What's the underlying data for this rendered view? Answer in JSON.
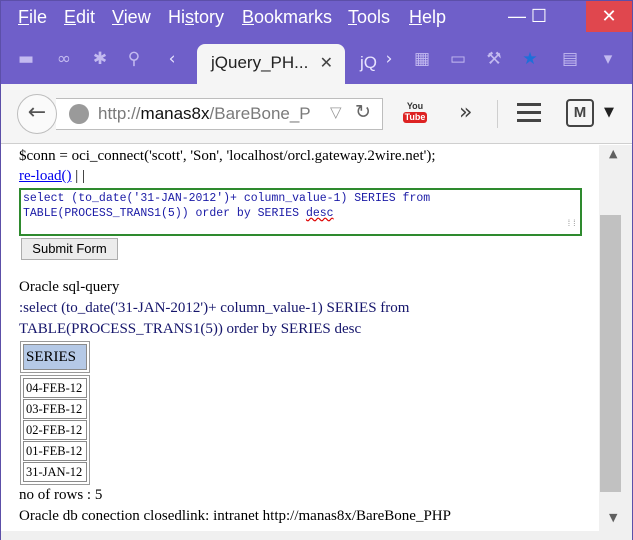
{
  "menubar": {
    "items": [
      "File",
      "Edit",
      "View",
      "History",
      "Bookmarks",
      "Tools",
      "Help"
    ],
    "underline_keys": [
      "F",
      "E",
      "V",
      "s",
      "B",
      "T",
      "H"
    ]
  },
  "window_controls": {
    "minimize": "—",
    "maximize": "☐",
    "close": "✕"
  },
  "tabs": {
    "active_title": "jQuery_PH...",
    "close_glyph": "✕",
    "next_title": "jQ",
    "scroll_left": "‹",
    "scroll_right": "›",
    "dropdown": "▾"
  },
  "navbar": {
    "back_glyph": "←",
    "url_prefix": "http://",
    "url_host": "manas8x",
    "url_path": "/BareBone_P",
    "url_dropdown": "▽",
    "reload_glyph": "↻",
    "youtube_top": "You",
    "youtube_bottom": "Tube",
    "overflow_glyph": "»",
    "addon_label": "M",
    "addon_dropdown": "▼"
  },
  "page": {
    "conn_line": "$conn = oci_connect('scott', 'Son', 'localhost/orcl.gateway.2wire.net');",
    "reload_link": "re-load()",
    "reload_suffix": " | |",
    "sql_text_1": "select (to_date('31-JAN-2012')+ column_value-1) SERIES from",
    "sql_text_2": "TABLE(PROCESS_TRANS1(5)) order by SERIES ",
    "sql_text_desc": "desc",
    "submit_label": "Submit Form",
    "oracle_label": "Oracle sql-query",
    "query_line_1": ":select (to_date('31-JAN-2012')+ column_value-1) SERIES from",
    "query_line_2": "TABLE(PROCESS_TRANS1(5)) order by SERIES desc",
    "table_header": "SERIES",
    "table_rows": [
      "04-FEB-12",
      "03-FEB-12",
      "02-FEB-12",
      "01-FEB-12",
      "31-JAN-12"
    ],
    "rows_info": "no of rows : 5",
    "closed_info": "Oracle db conection closedlink: intranet http://manas8x/BareBone_PHP"
  },
  "colors": {
    "titlebar": "#6f5fc9",
    "close_button": "#e0474e",
    "textarea_border": "#2e8a2e",
    "table_header_bg": "#b5c9e6",
    "link": "#0000ee"
  }
}
